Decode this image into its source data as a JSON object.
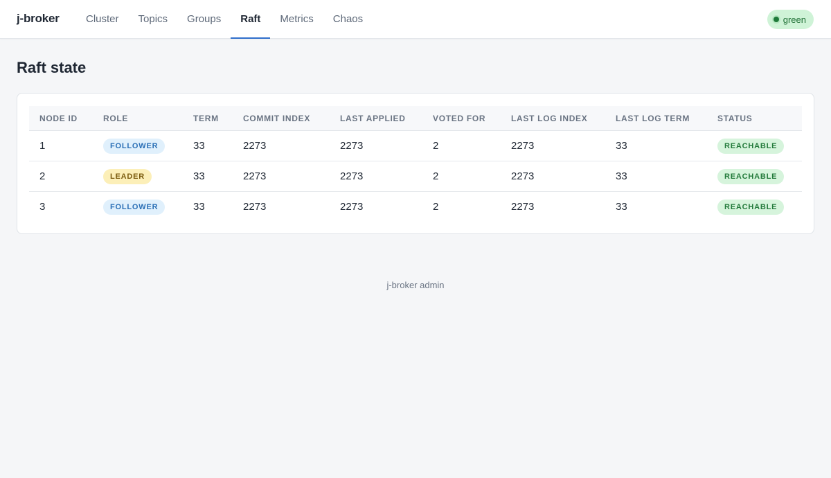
{
  "app": {
    "brand": "j-broker"
  },
  "nav": {
    "items": [
      {
        "label": "Cluster",
        "active": false
      },
      {
        "label": "Topics",
        "active": false
      },
      {
        "label": "Groups",
        "active": false
      },
      {
        "label": "Raft",
        "active": true
      },
      {
        "label": "Metrics",
        "active": false
      },
      {
        "label": "Chaos",
        "active": false
      }
    ]
  },
  "health": {
    "label": "green",
    "icon": "status-dot-icon",
    "color": "#1f7a3a"
  },
  "page": {
    "title": "Raft state"
  },
  "table": {
    "headers": [
      "NODE ID",
      "ROLE",
      "TERM",
      "COMMIT INDEX",
      "LAST APPLIED",
      "VOTED FOR",
      "LAST LOG INDEX",
      "LAST LOG TERM",
      "STATUS"
    ],
    "rows": [
      {
        "node_id": "1",
        "role": "FOLLOWER",
        "term": "33",
        "commit_index": "2273",
        "last_applied": "2273",
        "voted_for": "2",
        "last_log_index": "2273",
        "last_log_term": "33",
        "status": "REACHABLE"
      },
      {
        "node_id": "2",
        "role": "LEADER",
        "term": "33",
        "commit_index": "2273",
        "last_applied": "2273",
        "voted_for": "2",
        "last_log_index": "2273",
        "last_log_term": "33",
        "status": "REACHABLE"
      },
      {
        "node_id": "3",
        "role": "FOLLOWER",
        "term": "33",
        "commit_index": "2273",
        "last_applied": "2273",
        "voted_for": "2",
        "last_log_index": "2273",
        "last_log_term": "33",
        "status": "REACHABLE"
      }
    ]
  },
  "colors": {
    "accent": "#2f6ecb",
    "follower_badge": "#e0f0fc",
    "leader_badge": "#fcefb8",
    "reachable_badge": "#d6f4dc"
  },
  "footer": {
    "text": "j-broker admin"
  }
}
